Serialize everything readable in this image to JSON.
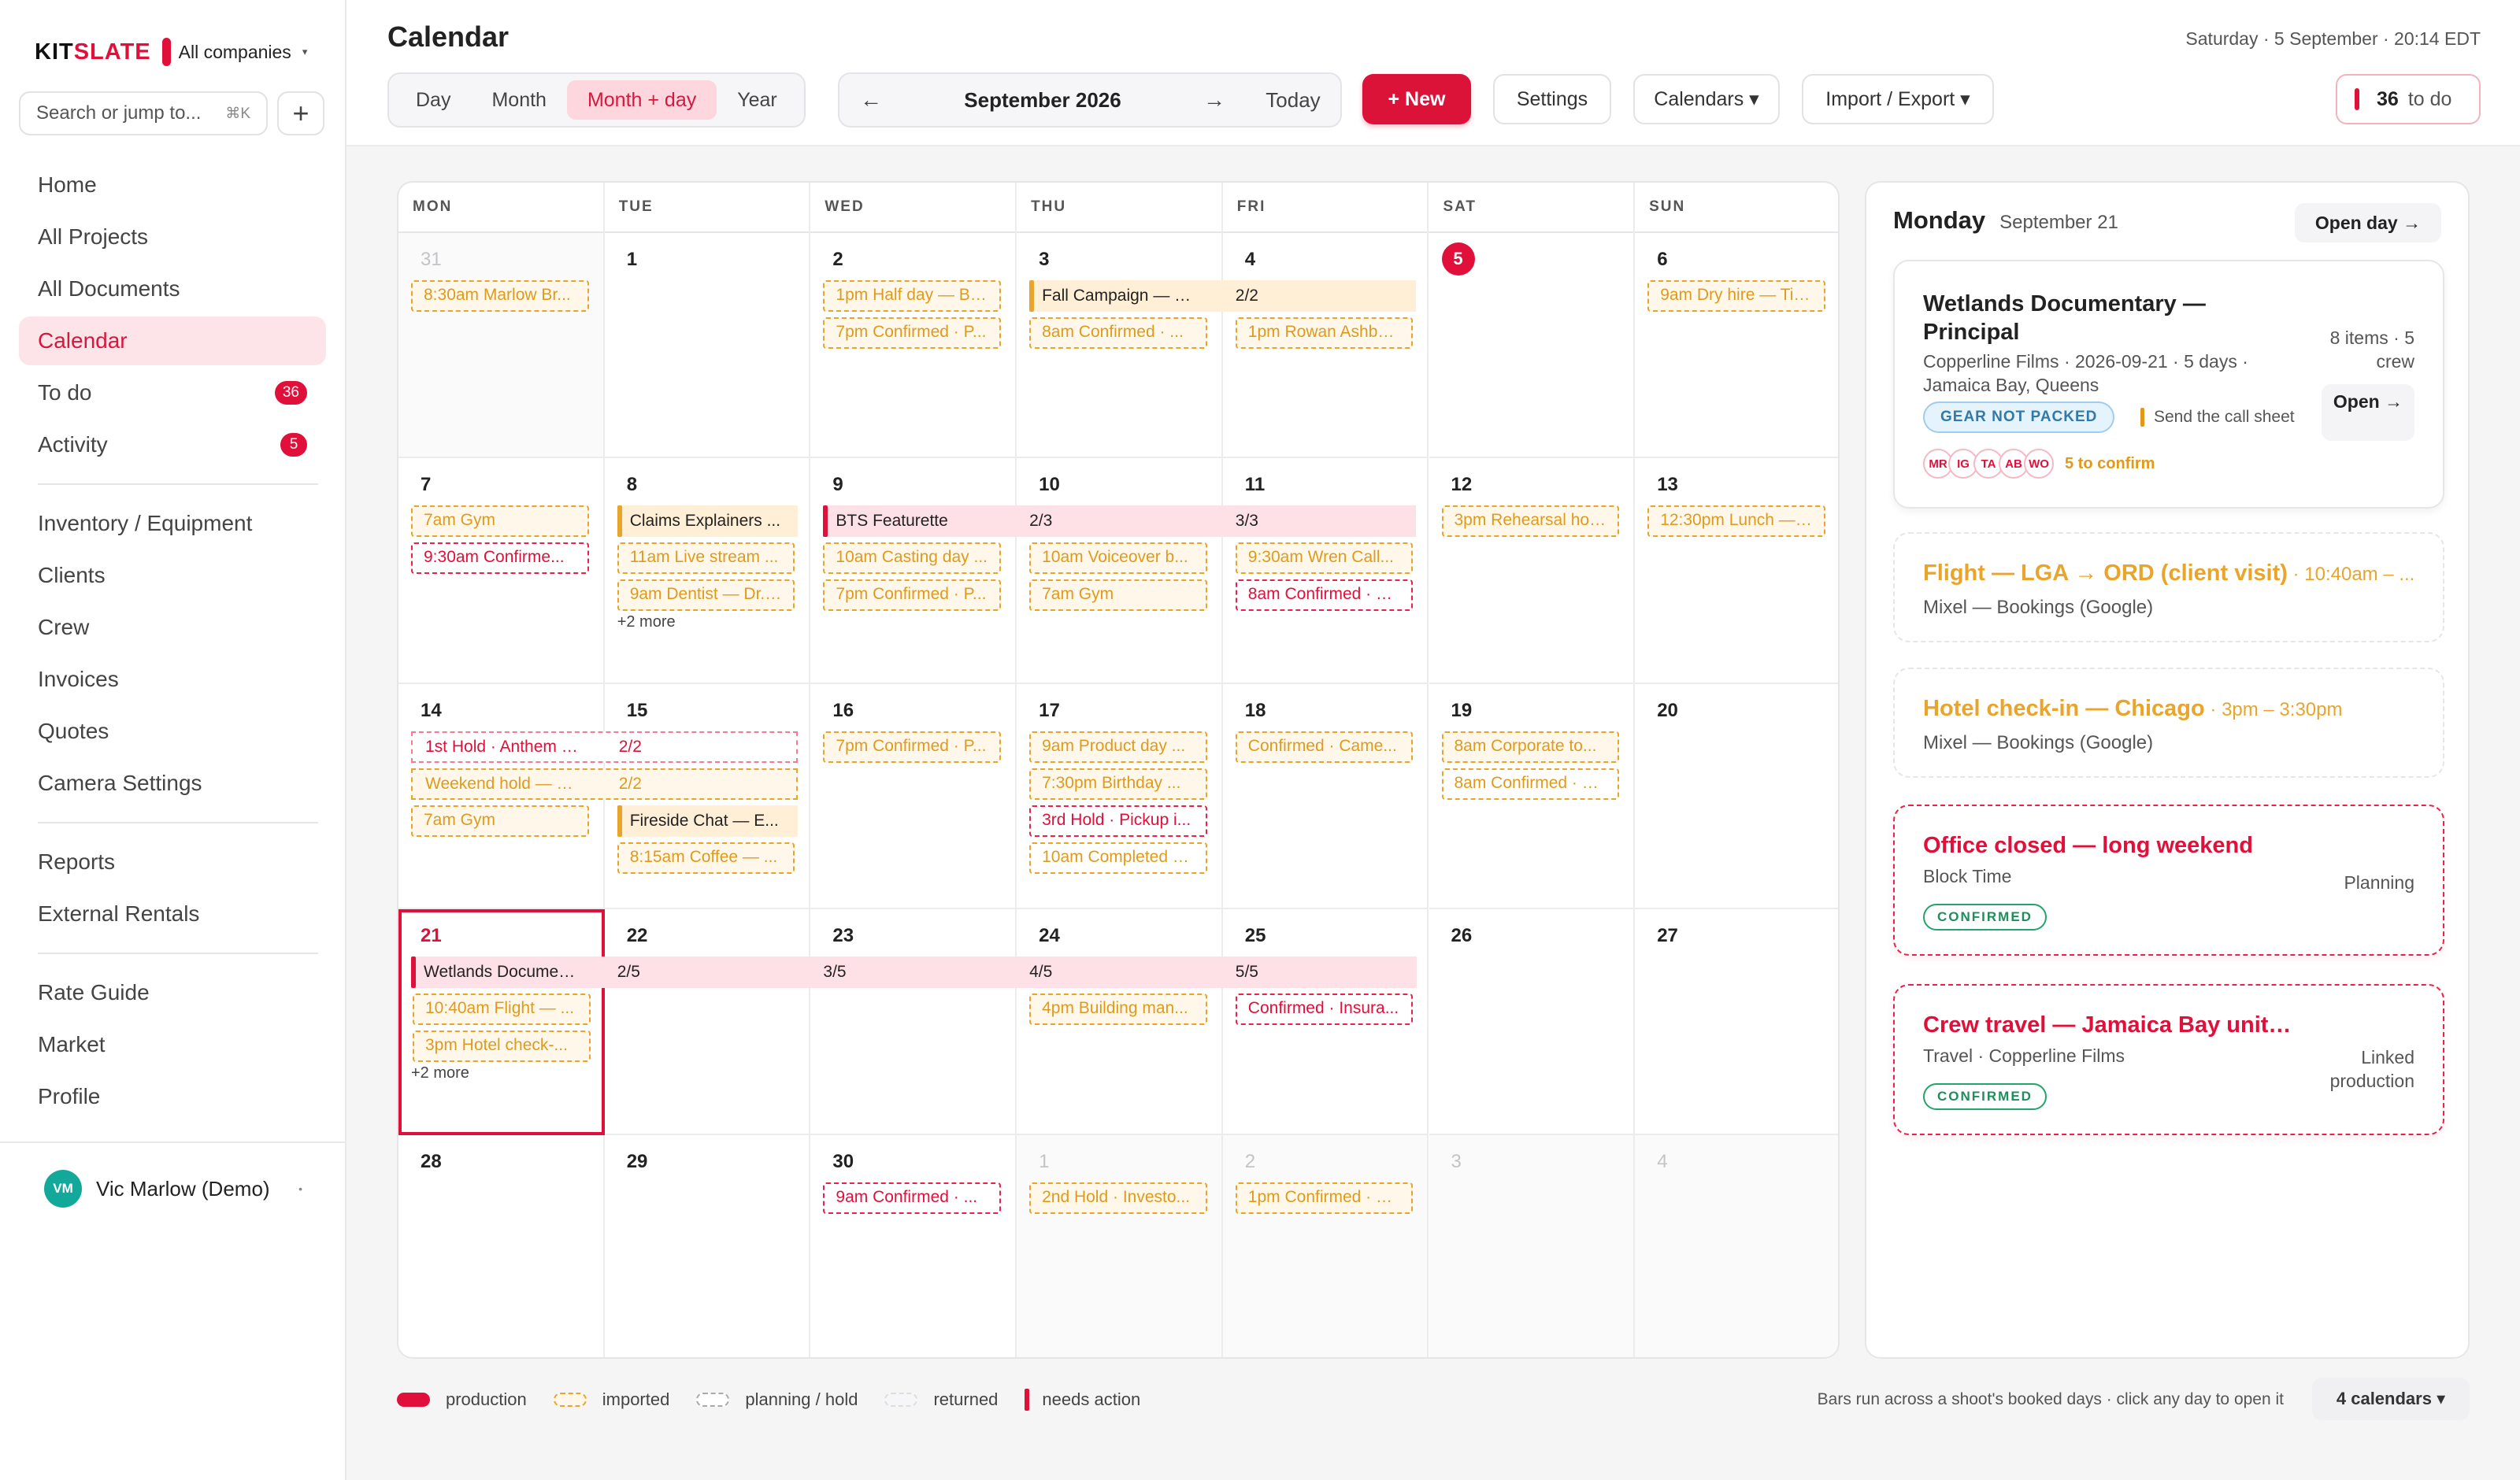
{
  "app": {
    "logo_pre": "KIT",
    "logo_acc": "SLATE",
    "company": "All companies"
  },
  "search": {
    "placeholder": "Search or jump to...",
    "shortcut": "⌘K"
  },
  "nav": {
    "items1": [
      {
        "name": "home",
        "label": "Home"
      },
      {
        "name": "all-projects",
        "label": "All Projects"
      },
      {
        "name": "all-documents",
        "label": "All Documents"
      },
      {
        "name": "calendar",
        "label": "Calendar",
        "active": true
      },
      {
        "name": "to-do",
        "label": "To do",
        "badge": "36"
      },
      {
        "name": "activity",
        "label": "Activity",
        "badge": "5"
      }
    ],
    "items2": [
      {
        "name": "inventory-equipment",
        "label": "Inventory / Equipment"
      },
      {
        "name": "clients",
        "label": "Clients"
      },
      {
        "name": "crew",
        "label": "Crew"
      },
      {
        "name": "invoices",
        "label": "Invoices"
      },
      {
        "name": "quotes",
        "label": "Quotes"
      },
      {
        "name": "camera-settings",
        "label": "Camera Settings"
      }
    ],
    "items3": [
      {
        "name": "reports",
        "label": "Reports"
      },
      {
        "name": "external-rentals",
        "label": "External Rentals"
      }
    ],
    "items4": [
      {
        "name": "rate-guide",
        "label": "Rate Guide"
      },
      {
        "name": "market",
        "label": "Market"
      },
      {
        "name": "profile",
        "label": "Profile"
      }
    ]
  },
  "user": {
    "initials": "VM",
    "name": "Vic Marlow (Demo)"
  },
  "header": {
    "title": "Calendar",
    "datetime": "Saturday · 5 September · 20:14 EDT",
    "views": [
      "Day",
      "Month",
      "Month + day",
      "Year"
    ],
    "active_view": "Month + day",
    "month_label": "September 2026",
    "today": "Today",
    "new": "+ New",
    "settings": "Settings",
    "calendars": "Calendars ▾",
    "import_export": "Import / Export ▾",
    "todo_count": "36",
    "todo_label": "to do"
  },
  "calendar": {
    "weekdays": [
      "MON",
      "TUE",
      "WED",
      "THU",
      "FRI",
      "SAT",
      "SUN"
    ],
    "weeks": [
      [
        {
          "d": "31",
          "out": true,
          "chips": [
            {
              "t": "8:30am Marlow Br...",
              "s": "imp"
            }
          ]
        },
        {
          "d": "1",
          "chips": []
        },
        {
          "d": "2",
          "chips": [
            {
              "t": "1pm Half day — Br...",
              "s": "imp"
            },
            {
              "t": "7pm Confirmed · P...",
              "s": "imp"
            }
          ]
        },
        {
          "d": "3",
          "chips": [
            {
              "t": "8am Confirmed · ...",
              "s": "imp",
              "slot": 1
            }
          ]
        },
        {
          "d": "4",
          "chips": [
            {
              "t": "1pm Rowan Ashby ...",
              "s": "imp",
              "slot": 1
            }
          ]
        },
        {
          "d": "5",
          "today": true,
          "chips": []
        },
        {
          "d": "6",
          "chips": [
            {
              "t": "9am Dry hire — Tid...",
              "s": "imp"
            }
          ]
        }
      ],
      [
        {
          "d": "7",
          "chips": [
            {
              "t": "7am Gym",
              "s": "imp"
            },
            {
              "t": "9:30am Confirme...",
              "s": "hold"
            }
          ]
        },
        {
          "d": "8",
          "chips": [
            {
              "t": "11am Live stream ...",
              "s": "imp",
              "slot": 1
            },
            {
              "t": "9am Dentist — Dr. ...",
              "s": "imp",
              "slot": 2
            }
          ],
          "more": "+2 more"
        },
        {
          "d": "9",
          "chips": [
            {
              "t": "10am Casting day ...",
              "s": "imp",
              "slot": 1
            },
            {
              "t": "7pm Confirmed · P...",
              "s": "imp",
              "slot": 2
            }
          ]
        },
        {
          "d": "10",
          "chips": [
            {
              "t": "10am Voiceover b...",
              "s": "imp",
              "slot": 1
            },
            {
              "t": "7am Gym",
              "s": "imp",
              "slot": 2
            }
          ]
        },
        {
          "d": "11",
          "chips": [
            {
              "t": "9:30am Wren Call...",
              "s": "imp",
              "slot": 1
            },
            {
              "t": "8am Confirmed · S...",
              "s": "hold",
              "slot": 2
            }
          ]
        },
        {
          "d": "12",
          "chips": [
            {
              "t": "3pm Rehearsal hol...",
              "s": "imp"
            }
          ]
        },
        {
          "d": "13",
          "chips": [
            {
              "t": "12:30pm Lunch — ...",
              "s": "imp"
            }
          ]
        }
      ],
      [
        {
          "d": "14",
          "chips": [
            {
              "t": "7am Gym",
              "s": "imp",
              "slot": 2
            }
          ]
        },
        {
          "d": "15",
          "chips": [
            {
              "t": "8:15am Coffee — ...",
              "s": "imp",
              "slot": 3
            }
          ]
        },
        {
          "d": "16",
          "chips": [
            {
              "t": "7pm Confirmed · P...",
              "s": "imp"
            }
          ]
        },
        {
          "d": "17",
          "chips": [
            {
              "t": "9am Product day ...",
              "s": "imp"
            },
            {
              "t": "7:30pm Birthday ...",
              "s": "imp"
            },
            {
              "t": "3rd Hold · Pickup i...",
              "s": "hold"
            },
            {
              "t": "10am Completed · ...",
              "s": "imp2"
            }
          ]
        },
        {
          "d": "18",
          "chips": [
            {
              "t": "Confirmed · Came...",
              "s": "imp"
            }
          ]
        },
        {
          "d": "19",
          "chips": [
            {
              "t": "8am Corporate to...",
              "s": "imp"
            },
            {
              "t": "8am Confirmed · S...",
              "s": "imp2"
            }
          ]
        },
        {
          "d": "20",
          "chips": []
        }
      ],
      [
        {
          "d": "21",
          "selected": true,
          "chips": [
            {
              "t": "10:40am Flight — ...",
              "s": "imp",
              "slot": 1
            },
            {
              "t": "3pm Hotel check-...",
              "s": "imp",
              "slot": 2
            }
          ],
          "more": "+2 more"
        },
        {
          "d": "22",
          "chips": []
        },
        {
          "d": "23",
          "chips": []
        },
        {
          "d": "24",
          "chips": [
            {
              "t": "4pm Building man...",
              "s": "imp",
              "slot": 1
            }
          ]
        },
        {
          "d": "25",
          "chips": [
            {
              "t": "Confirmed · Insura...",
              "s": "hold",
              "slot": 1
            }
          ]
        },
        {
          "d": "26",
          "chips": []
        },
        {
          "d": "27",
          "chips": []
        }
      ],
      [
        {
          "d": "28",
          "chips": []
        },
        {
          "d": "29",
          "chips": []
        },
        {
          "d": "30",
          "chips": [
            {
              "t": "9am Confirmed · ...",
              "s": "hold"
            }
          ]
        },
        {
          "d": "1",
          "out": true,
          "chips": [
            {
              "t": "2nd Hold · Investo...",
              "s": "imp"
            }
          ]
        },
        {
          "d": "2",
          "out": true,
          "chips": [
            {
              "t": "1pm Confirmed · G...",
              "s": "imp"
            }
          ]
        },
        {
          "d": "3",
          "out": true,
          "chips": []
        },
        {
          "d": "4",
          "out": true,
          "chips": []
        }
      ]
    ],
    "spans": [
      {
        "week": 0,
        "slot": 0,
        "start": 3,
        "end": 4,
        "style": "orange",
        "bar": "#e9a52b",
        "segs": [
          "Fall Campaign — Lo...",
          "2/2"
        ]
      },
      {
        "week": 1,
        "slot": 0,
        "start": 1,
        "end": 1,
        "style": "orange",
        "bar": "#e9a52b",
        "segs": [
          "Claims Explainers ..."
        ]
      },
      {
        "week": 1,
        "slot": 0,
        "start": 2,
        "end": 4,
        "style": "pink",
        "bar": "#e0103a",
        "segs": [
          "BTS Featurette",
          "2/3",
          "3/3"
        ]
      },
      {
        "week": 2,
        "slot": 0,
        "start": 0,
        "end": 1,
        "style": "pinkout",
        "segs": [
          "1st Hold · Anthem Sp...",
          "2/2"
        ]
      },
      {
        "week": 2,
        "slot": 1,
        "start": 0,
        "end": 1,
        "style": "orangeout",
        "segs": [
          "Weekend hold — Sil...",
          "2/2"
        ]
      },
      {
        "week": 2,
        "slot": 2,
        "start": 1,
        "end": 1,
        "style": "orange",
        "bar": "#e9a52b",
        "segs": [
          "Fireside Chat — E..."
        ]
      },
      {
        "week": 3,
        "slot": 0,
        "start": 0,
        "end": 4,
        "style": "pink",
        "bar": "#e0103a",
        "segs": [
          "Wetlands Documen...",
          "2/5",
          "3/5",
          "4/5",
          "5/5"
        ]
      }
    ]
  },
  "panel": {
    "day": "Monday",
    "date": "September 21",
    "open_day": "Open day →",
    "main": {
      "title": "Wetlands Documentary — Principal",
      "sub": "Copperline Films · 2026-09-21 · 5 days · Jamaica Bay, Queens",
      "meta": "8 items · 5 crew",
      "open": "Open →",
      "gear": "GEAR NOT PACKED",
      "callsheet": "Send the call sheet",
      "crew": [
        "MR",
        "IG",
        "TA",
        "AB",
        "WO"
      ],
      "confirm": "5 to confirm"
    },
    "imported": [
      {
        "title": "Flight — LGA → ORD (client visit)",
        "time": " · 10:40am – ...",
        "sub": "Mixel — Bookings (Google)"
      },
      {
        "title": "Hotel check-in — Chicago",
        "time": " · 3pm – 3:30pm",
        "sub": "Mixel — Bookings (Google)"
      }
    ],
    "holds": [
      {
        "title": "Office closed — long weekend",
        "sub": "Block Time",
        "side": "Planning",
        "badge": "CONFIRMED"
      },
      {
        "title": "Crew travel — Jamaica Bay unit ...",
        "sub": "Travel · Copperline Films",
        "side": "Linked production",
        "badge": "CONFIRMED"
      }
    ]
  },
  "legend": {
    "items": [
      "production",
      "imported",
      "planning / hold",
      "returned",
      "needs action"
    ],
    "note": "Bars run across a shoot's booked days · click any day to open it",
    "calendars_btn": "4 calendars ▾"
  }
}
